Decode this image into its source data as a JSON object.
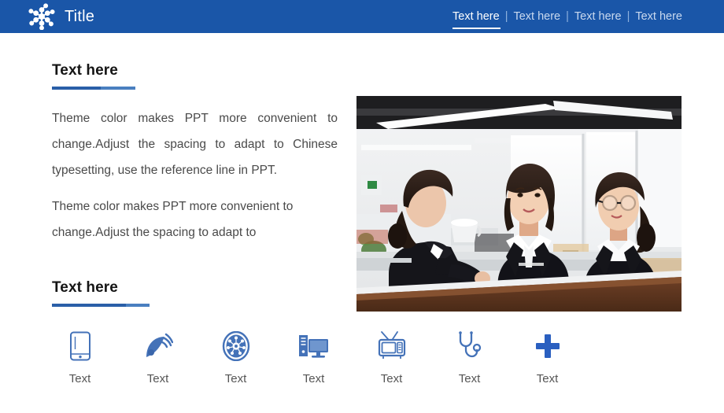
{
  "header": {
    "logo_icon": "molecule-icon",
    "title": "Title",
    "separator": "|",
    "nav": [
      {
        "label": "Text here",
        "active": true
      },
      {
        "label": "Text here",
        "active": false
      },
      {
        "label": "Text here",
        "active": false
      },
      {
        "label": "Text here",
        "active": false
      }
    ]
  },
  "content": {
    "section1": {
      "heading": "Text here",
      "paragraph1": "Theme color makes PPT more convenient to change.Adjust the spacing to adapt to Chinese typesetting, use the reference line in PPT.",
      "paragraph2": "Theme color makes PPT more convenient to change.Adjust the spacing to adapt to"
    },
    "section2": {
      "heading": "Text here"
    }
  },
  "photo": {
    "alt": "Three women in black business suits talking at a wooden counter in a bright modern office"
  },
  "icons": [
    {
      "name": "tablet-icon",
      "label": "Text"
    },
    {
      "name": "satellite-dish-icon",
      "label": "Text"
    },
    {
      "name": "gear-wheel-icon",
      "label": "Text"
    },
    {
      "name": "desktop-computer-icon",
      "label": "Text"
    },
    {
      "name": "television-icon",
      "label": "Text"
    },
    {
      "name": "stethoscope-icon",
      "label": "Text"
    },
    {
      "name": "plus-icon",
      "label": "Text"
    }
  ],
  "colors": {
    "header_blue": "#1a56a8",
    "accent_blue": "#2a5fa8",
    "accent_blue_light": "#4a7fc0",
    "icon_blue": "#4472b8",
    "body_text": "#4a4a4a",
    "heading_text": "#141414",
    "nav_inactive": "#c9d9ef"
  }
}
